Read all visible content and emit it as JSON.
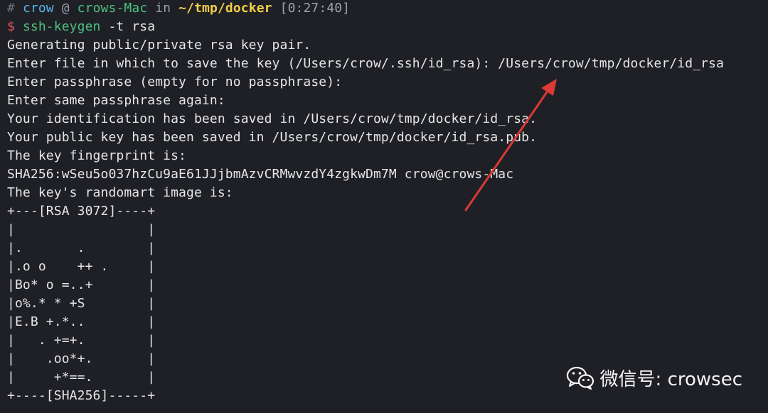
{
  "prompt": {
    "hash": "#",
    "user": "crow",
    "at": "@",
    "host": "crows-Mac",
    "in": "in",
    "dir": "~/tmp/docker",
    "time": "[0:27:40]"
  },
  "command": {
    "dollar": "$",
    "program": "ssh-keygen",
    "args": " -t rsa"
  },
  "output": [
    "Generating public/private rsa key pair.",
    "Enter file in which to save the key (/Users/crow/.ssh/id_rsa): /Users/crow/tmp/docker/id_rsa",
    "Enter passphrase (empty for no passphrase):",
    "Enter same passphrase again:",
    "Your identification has been saved in /Users/crow/tmp/docker/id_rsa.",
    "Your public key has been saved in /Users/crow/tmp/docker/id_rsa.pub.",
    "The key fingerprint is:",
    "SHA256:wSeu5o037hzCu9aE61JJjbmAzvCRMwvzdY4zgkwDm7M crow@crows-Mac",
    "The key's randomart image is:",
    "+---[RSA 3072]----+",
    "|                 |",
    "|.       .        |",
    "|.o o    ++ .     |",
    "|Bo* o =..+       |",
    "|o%.* * +S        |",
    "|E.B +.*..        |",
    "|   . +=+.        |",
    "|    .oo*+.       |",
    "|     +*==.       |",
    "+----[SHA256]-----+"
  ],
  "annotation": {
    "arrow_color": "#d93a32"
  },
  "colors": {
    "background": "#1f2026",
    "text": "#e6e6e6",
    "user": "#58b6e8",
    "host": "#4cc17e",
    "dir": "#f2cf4a",
    "dollar": "#e05a5a"
  },
  "watermark": {
    "icon": "wechat-icon",
    "text": "微信号: crowsec"
  }
}
